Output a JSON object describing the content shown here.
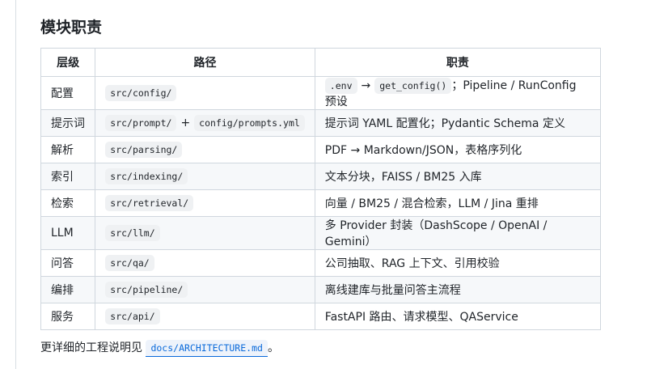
{
  "section": {
    "title": "模块职责"
  },
  "table": {
    "headers": [
      "层级",
      "路径",
      "职责"
    ],
    "rows": [
      {
        "layer": "配置",
        "path": [
          "src/config/"
        ],
        "duty_code1": ".env",
        "duty_arrow": "→",
        "duty_code2": "get_config()",
        "duty_text": "；Pipeline / RunConfig 预设"
      },
      {
        "layer": "提示词",
        "path": [
          "src/prompt/",
          "config/prompts.yml"
        ],
        "path_sep": "+",
        "duty_text": "提示词 YAML 配置化；Pydantic Schema 定义"
      },
      {
        "layer": "解析",
        "path": [
          "src/parsing/"
        ],
        "duty_text": "PDF → Markdown/JSON，表格序列化"
      },
      {
        "layer": "索引",
        "path": [
          "src/indexing/"
        ],
        "duty_text": "文本分块，FAISS / BM25 入库"
      },
      {
        "layer": "检索",
        "path": [
          "src/retrieval/"
        ],
        "duty_text": "向量 / BM25 / 混合检索，LLM / Jina 重排"
      },
      {
        "layer": "LLM",
        "path": [
          "src/llm/"
        ],
        "duty_text": "多 Provider 封装（DashScope / OpenAI / Gemini）"
      },
      {
        "layer": "问答",
        "path": [
          "src/qa/"
        ],
        "duty_text": "公司抽取、RAG 上下文、引用校验"
      },
      {
        "layer": "编排",
        "path": [
          "src/pipeline/"
        ],
        "duty_text": "离线建库与批量问答主流程"
      },
      {
        "layer": "服务",
        "path": [
          "src/api/"
        ],
        "duty_text": "FastAPI 路由、请求模型、QAService"
      }
    ]
  },
  "footer": {
    "prefix": "更详细的工程说明见",
    "link": "docs/ARCHITECTURE.md",
    "suffix": "。"
  },
  "colors": {
    "link": "#0969da",
    "border": "#d0d7de",
    "stripe": "#f6f8fa"
  }
}
